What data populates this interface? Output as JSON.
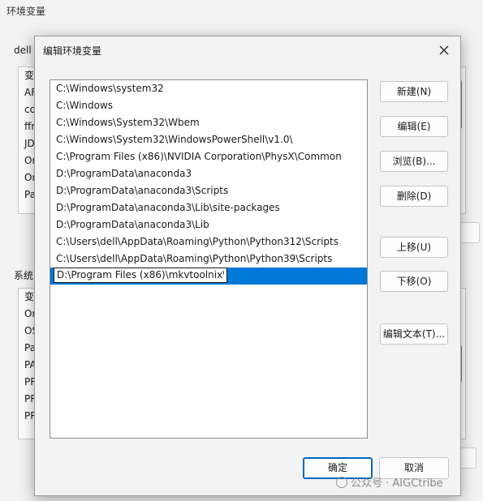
{
  "background": {
    "title": "环境变量",
    "user_label": "dell",
    "user_rows": [
      "变",
      "AF",
      "co",
      "ffr",
      "JD",
      "On",
      "On",
      "Pa"
    ],
    "system_label": "系统",
    "system_rows": [
      "变",
      "On",
      "OS",
      "Pa",
      "PA",
      "PR",
      "PR",
      "PR"
    ]
  },
  "dialog": {
    "title": "编辑环境变量",
    "paths": [
      "C:\\Windows\\system32",
      "C:\\Windows",
      "C:\\Windows\\System32\\Wbem",
      "C:\\Windows\\System32\\WindowsPowerShell\\v1.0\\",
      "C:\\Program Files (x86)\\NVIDIA Corporation\\PhysX\\Common",
      "D:\\ProgramData\\anaconda3",
      "D:\\ProgramData\\anaconda3\\Scripts",
      "D:\\ProgramData\\anaconda3\\Lib\\site-packages",
      "D:\\ProgramData\\anaconda3\\Lib",
      "C:\\Users\\dell\\AppData\\Roaming\\Python\\Python312\\Scripts",
      "C:\\Users\\dell\\AppData\\Roaming\\Python\\Python39\\Scripts"
    ],
    "editing_value": "D:\\Program Files (x86)\\mkvtoolnix\\",
    "buttons": {
      "new": "新建(N)",
      "edit": "编辑(E)",
      "browse": "浏览(B)...",
      "delete": "删除(D)",
      "move_up": "上移(U)",
      "move_down": "下移(O)",
      "edit_text": "编辑文本(T)...",
      "ok": "确定",
      "cancel": "取消"
    },
    "accent_color": "#0078d7"
  },
  "watermark": "公众号 · AIGCtribe"
}
